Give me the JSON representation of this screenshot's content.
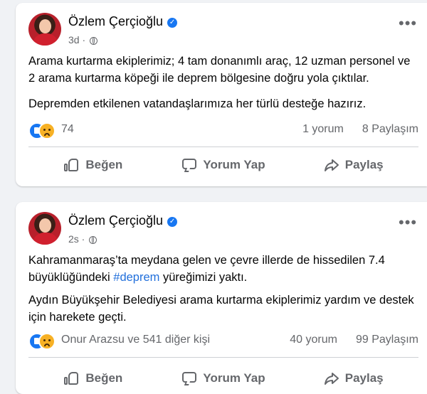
{
  "posts": [
    {
      "author": "Özlem Çerçioğlu",
      "time": "3d",
      "paragraphs": [
        "Arama kurtarma ekiplerimiz; 4 tam donanımlı araç, 12 uzman personel ve 2 arama kurtarma köpeği ile deprem bölgesine doğru yola çıktılar.",
        "Depremden etkilenen vatandaşlarımıza her türlü desteğe hazırız."
      ],
      "reaction_count": "74",
      "comments": "1 yorum",
      "shares": "8 Paylaşım",
      "actions": {
        "like": "Beğen",
        "comment": "Yorum Yap",
        "share": "Paylaş"
      }
    },
    {
      "author": "Özlem Çerçioğlu",
      "time": "2s",
      "paragraph1_before": "Kahramanmaraş’ta meydana gelen ve çevre illerde de hissedilen 7.4 büyüklüğündeki ",
      "hashtag": "#deprem",
      "paragraph1_after": " yüreğimizi yaktı.",
      "paragraph2": "Aydın Büyükşehir Belediyesi arama kurtarma ekiplerimiz yardım ve destek için harekete geçti.",
      "reaction_count": "Onur Arazsu ve 541 diğer kişi",
      "comments": "40 yorum",
      "shares": "99 Paylaşım",
      "actions": {
        "like": "Beğen",
        "comment": "Yorum Yap",
        "share": "Paylaş"
      }
    }
  ],
  "icons": [
    "verified-badge-icon",
    "globe-icon",
    "more-options-icon",
    "like-reaction-icon",
    "sad-reaction-icon",
    "like-icon",
    "comment-icon",
    "share-icon"
  ],
  "colors": {
    "accent": "#1877f2",
    "hashtag": "#216fdb",
    "muted": "#65676b",
    "background": "#f0f2f5"
  }
}
